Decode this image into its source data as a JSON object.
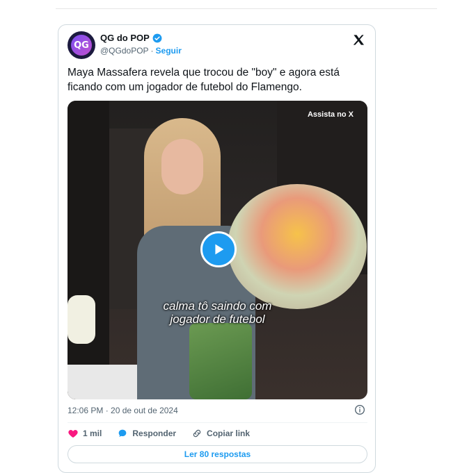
{
  "author": {
    "avatar_text": "QG",
    "name": "QG do POP",
    "handle": "@QGdoPOP",
    "separator": "·",
    "follow_label": "Seguir"
  },
  "tweet": {
    "text": "Maya Massafera revela que trocou de \"boy\" e agora está ficando com um jogador de futebol do Flamengo."
  },
  "media": {
    "watch_label": "Assista no X",
    "caption_line1": "calma tô saindo com",
    "caption_line2": "jogador de futebol"
  },
  "meta": {
    "timestamp": "12:06 PM · 20 de out de 2024"
  },
  "actions": {
    "like_count": "1 mil",
    "reply_label": "Responder",
    "copy_label": "Copiar link"
  },
  "footer": {
    "read_replies_label": "Ler 80 respostas"
  },
  "colors": {
    "accent": "#1d9bf0",
    "like": "#f91880",
    "text": "#0f1419",
    "muted": "#536471"
  },
  "icons": [
    "verified-badge-icon",
    "x-logo-icon",
    "play-icon",
    "info-icon",
    "heart-icon",
    "reply-bubble-icon",
    "link-icon"
  ]
}
